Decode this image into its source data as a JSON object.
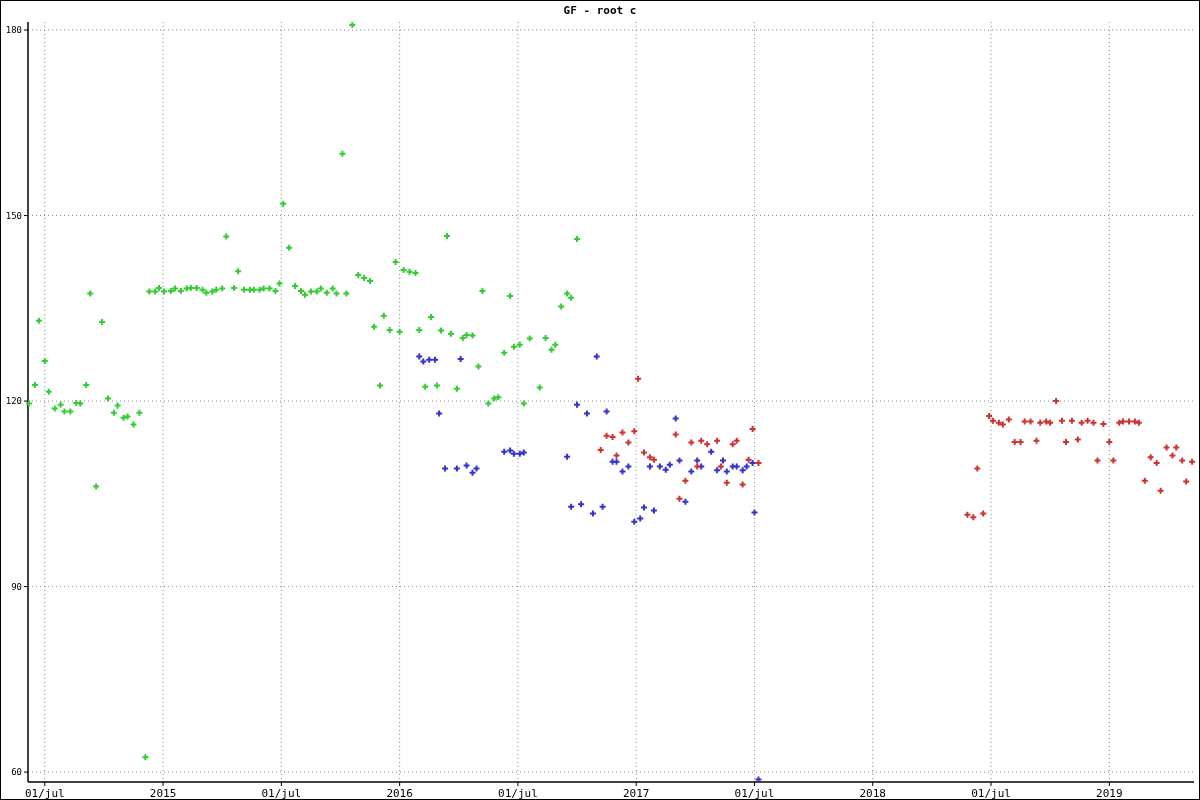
{
  "chart": {
    "chart_data": {
      "type": "scatter",
      "title": "GF - root c",
      "grid": true,
      "xlim": [
        2014.429,
        2019.358
      ],
      "ylim": [
        58.4,
        181.3
      ],
      "xticks": [
        {
          "value": 2014.5,
          "label": "01/jul"
        },
        2015,
        {
          "value": 2015.5,
          "label": "01/jul"
        },
        2016,
        {
          "value": 2016.5,
          "label": "01/jul"
        },
        2017,
        {
          "value": 2017.5,
          "label": "01/jul"
        },
        2018,
        {
          "value": 2018.5,
          "label": "01/jul"
        },
        2019
      ],
      "yticks": [
        60,
        90,
        120,
        150,
        180
      ],
      "series": [
        {
          "color": "#33cc33",
          "x": [
            2014.433,
            2014.458,
            2014.475,
            2014.5,
            2014.517,
            2014.542,
            2014.567,
            2014.583,
            2014.608,
            2014.633,
            2014.65,
            2014.675,
            2014.692,
            2014.717,
            2014.742,
            2014.767,
            2014.792,
            2014.808,
            2014.833,
            2014.85,
            2014.875,
            2014.9,
            2014.925,
            2014.942,
            2014.967,
            2014.983,
            2015.004,
            2015.033,
            2015.05,
            2015.075,
            2015.1,
            2015.117,
            2015.142,
            2015.167,
            2015.183,
            2015.208,
            2015.225,
            2015.25,
            2015.267,
            2015.3,
            2015.317,
            2015.342,
            2015.367,
            2015.383,
            2015.408,
            2015.425,
            2015.45,
            2015.475,
            2015.492,
            2015.508,
            2015.533,
            2015.558,
            2015.583,
            2015.6,
            2015.625,
            2015.65,
            2015.667,
            2015.692,
            2015.717,
            2015.733,
            2015.758,
            2015.775,
            2015.8,
            2015.825,
            2015.85,
            2015.875,
            2015.892,
            2015.917,
            2015.933,
            2015.958,
            2015.983,
            2016.0,
            2016.017,
            2016.042,
            2016.067,
            2016.083,
            2016.108,
            2016.133,
            2016.158,
            2016.175,
            2016.2,
            2016.217,
            2016.242,
            2016.267,
            2016.283,
            2016.308,
            2016.333,
            2016.35,
            2016.375,
            2016.4,
            2016.417,
            2016.442,
            2016.467,
            2016.483,
            2016.508,
            2016.525,
            2016.55,
            2016.592,
            2016.617,
            2016.642,
            2016.658,
            2016.683,
            2016.708,
            2016.725,
            2016.75
          ],
          "values": [
            119.6,
            122.6,
            133,
            126.5,
            121.5,
            118.8,
            119.4,
            118.3,
            118.3,
            119.7,
            119.6,
            122.6,
            137.4,
            106.2,
            132.8,
            120.4,
            118.1,
            119.3,
            117.3,
            117.5,
            116.2,
            118.1,
            62.4,
            137.7,
            137.7,
            138.3,
            137.7,
            137.8,
            138.2,
            137.8,
            138.2,
            138.3,
            138.3,
            138,
            137.5,
            137.7,
            138,
            138.2,
            146.6,
            138.3,
            141,
            138,
            138,
            138,
            138,
            138.2,
            138.2,
            137.8,
            139,
            151.9,
            144.8,
            138.6,
            137.8,
            137.2,
            137.7,
            137.7,
            138.2,
            137.5,
            138.2,
            137.4,
            160,
            137.4,
            180.8,
            140.4,
            139.9,
            139.4,
            132,
            122.5,
            133.8,
            131.5,
            142.5,
            131.2,
            141.2,
            140.9,
            140.7,
            131.5,
            122.3,
            133.6,
            122.5,
            131.4,
            146.7,
            130.9,
            122,
            130.2,
            130.7,
            130.6,
            125.6,
            137.8,
            119.6,
            120.4,
            120.6,
            127.8,
            137,
            128.8,
            129.1,
            119.6,
            130.1,
            122.2,
            130.2,
            128.3,
            129.1,
            135.3,
            137.4,
            136.7,
            146.2
          ]
        },
        {
          "color": "#3333cc",
          "x": [
            2016.083,
            2016.1,
            2016.125,
            2016.15,
            2016.167,
            2016.192,
            2016.242,
            2016.258,
            2016.283,
            2016.308,
            2016.325,
            2016.442,
            2016.467,
            2016.483,
            2016.508,
            2016.525,
            2016.708,
            2016.725,
            2016.75,
            2016.767,
            2016.792,
            2016.817,
            2016.833,
            2016.858,
            2016.875,
            2016.9,
            2016.917,
            2016.942,
            2016.967,
            2016.992,
            2017.017,
            2017.033,
            2017.058,
            2017.075,
            2017.1,
            2017.125,
            2017.142,
            2017.167,
            2017.183,
            2017.208,
            2017.233,
            2017.258,
            2017.275,
            2017.317,
            2017.342,
            2017.367,
            2017.383,
            2017.408,
            2017.425,
            2017.45,
            2017.467,
            2017.492,
            2017.5,
            2017.517
          ],
          "values": [
            127.2,
            126.4,
            126.7,
            126.7,
            118,
            109.1,
            109.1,
            126.8,
            109.6,
            108.4,
            109.1,
            111.8,
            112,
            111.5,
            111.5,
            111.7,
            111,
            102.9,
            119.4,
            103.3,
            118,
            101.8,
            127.2,
            102.9,
            118.3,
            110.2,
            110.2,
            108.6,
            109.4,
            100.5,
            101,
            102.8,
            109.4,
            102.3,
            109.4,
            108.9,
            109.7,
            117.2,
            110.4,
            103.7,
            108.6,
            110.4,
            109.4,
            111.8,
            108.8,
            110.4,
            108.6,
            109.4,
            109.4,
            108.8,
            109.4,
            110,
            102,
            58.8
          ]
        },
        {
          "color": "#cc3333",
          "x": [
            2016.85,
            2016.875,
            2016.9,
            2016.917,
            2016.942,
            2016.967,
            2016.992,
            2017.008,
            2017.033,
            2017.058,
            2017.075,
            2017.167,
            2017.183,
            2017.208,
            2017.233,
            2017.258,
            2017.275,
            2017.3,
            2017.342,
            2017.358,
            2017.383,
            2017.408,
            2017.425,
            2017.45,
            2017.475,
            2017.492,
            2017.517,
            2018.4,
            2018.425,
            2018.442,
            2018.467,
            2018.492,
            2018.508,
            2018.533,
            2018.55,
            2018.575,
            2018.6,
            2018.625,
            2018.642,
            2018.667,
            2018.692,
            2018.708,
            2018.733,
            2018.75,
            2018.775,
            2018.8,
            2018.817,
            2018.842,
            2018.867,
            2018.883,
            2018.908,
            2018.933,
            2018.95,
            2018.975,
            2019.0,
            2019.017,
            2019.042,
            2019.058,
            2019.083,
            2019.108,
            2019.125,
            2019.15,
            2019.175,
            2019.2,
            2019.217,
            2019.242,
            2019.267,
            2019.283,
            2019.308,
            2019.325,
            2019.35
          ],
          "values": [
            112.1,
            114.4,
            114.2,
            111.2,
            114.9,
            113.3,
            115.1,
            123.6,
            111.7,
            110.9,
            110.5,
            114.6,
            104.2,
            107.1,
            113.3,
            109.4,
            113.6,
            113,
            113.6,
            109.4,
            106.8,
            113,
            113.6,
            106.5,
            110.5,
            115.5,
            110,
            101.6,
            101.2,
            109.1,
            101.8,
            117.6,
            116.8,
            116.5,
            116.2,
            117,
            113.4,
            113.4,
            116.7,
            116.7,
            113.6,
            116.5,
            116.7,
            116.5,
            120,
            116.8,
            113.4,
            116.8,
            113.8,
            116.5,
            116.8,
            116.5,
            110.4,
            116.3,
            113.4,
            110.4,
            116.5,
            116.7,
            116.7,
            116.7,
            116.5,
            107.1,
            110.9,
            110,
            105.5,
            112.5,
            111.2,
            112.5,
            110.4,
            107,
            110.2
          ]
        }
      ]
    }
  }
}
